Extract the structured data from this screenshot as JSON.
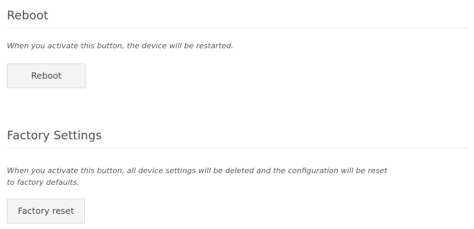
{
  "reboot": {
    "title": "Reboot",
    "description": "When you activate this button, the device will be restarted.",
    "button_label": "Reboot"
  },
  "factory": {
    "title": "Factory Settings",
    "description_line1": "When you activate this button, all device settings will be deleted and the configuration will be reset",
    "description_line2": "to factory defaults.",
    "button_label": "Factory reset"
  }
}
